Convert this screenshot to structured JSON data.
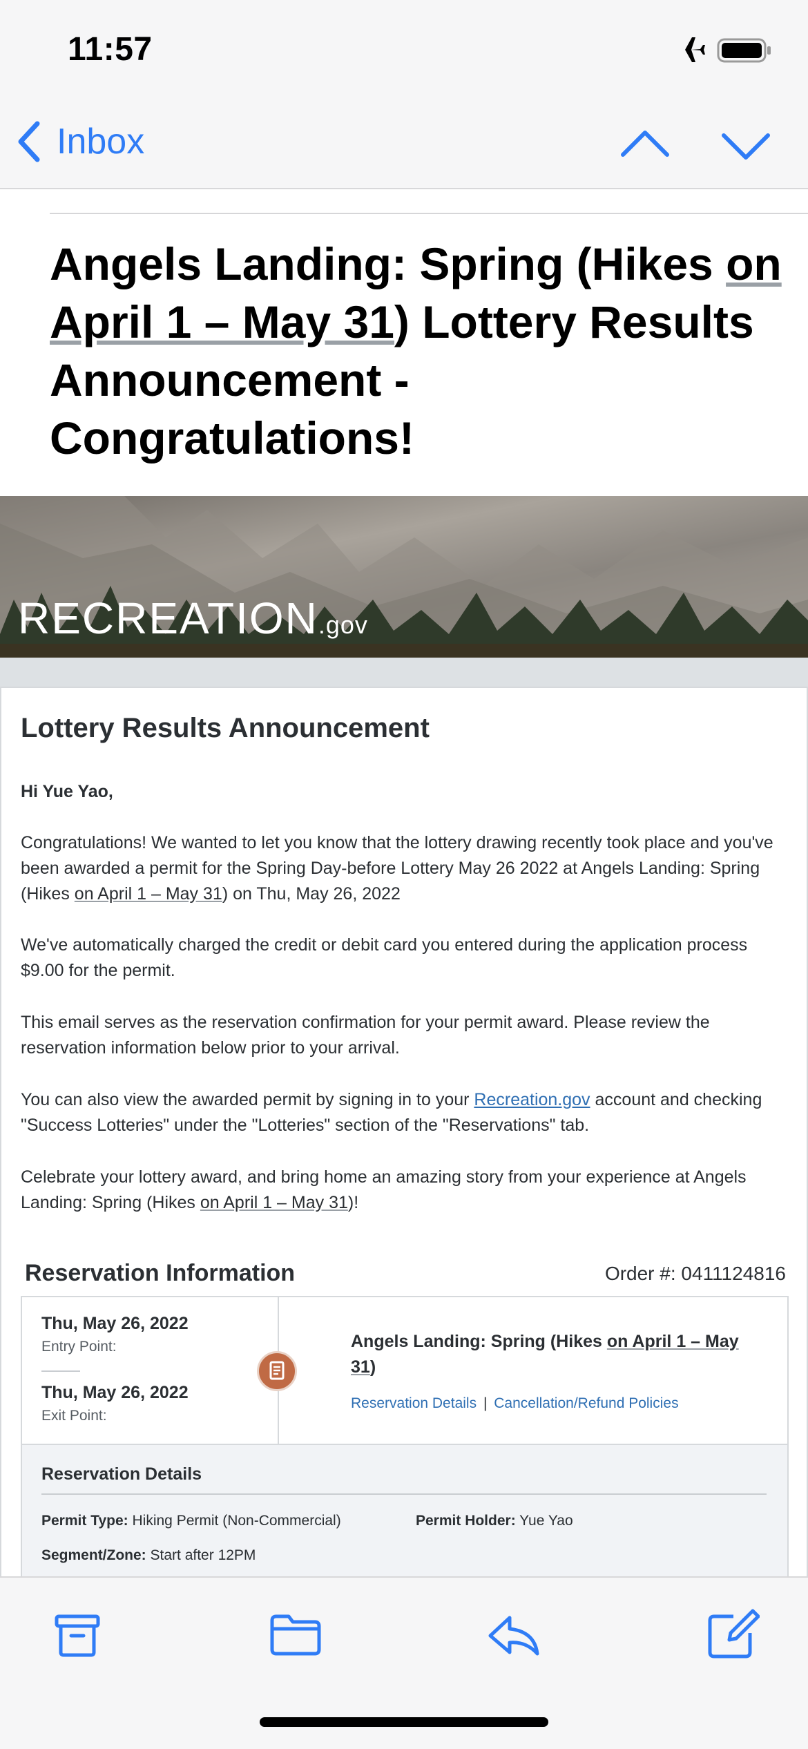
{
  "status": {
    "time": "11:57"
  },
  "nav": {
    "back_label": "Inbox"
  },
  "email": {
    "subject": {
      "part1": "Angels Landing: Spring (Hikes ",
      "underlined": "on April 1 – May 31",
      "part2": ") Lottery Results Announcement - Congratulations!"
    },
    "banner": {
      "logo_main": "RECREATION",
      "logo_suffix": ".gov"
    },
    "card": {
      "title": "Lottery Results Announcement",
      "greeting": "Hi Yue Yao,",
      "p1_a": "Congratulations! We wanted to let you know that the lottery drawing recently took place and you've been awarded a permit for the Spring Day-before Lottery May 26 2022 at Angels Landing: Spring (Hikes ",
      "p1_ul": "on April 1 – May 31",
      "p1_b": ") on Thu, May 26, 2022",
      "p2": "We've automatically charged the credit or debit card you entered during the application process $9.00 for the permit.",
      "p3": "This email serves as the reservation confirmation for your permit award. Please review the reservation information below prior to your arrival.",
      "p4_a": "You can also view the awarded permit by signing in to your ",
      "p4_link": "Recreation.gov",
      "p4_b": " account and checking \"Success Lotteries\" under the \"Lotteries\" section of the \"Reservations\" tab.",
      "p5_a": "Celebrate your lottery award, and bring home an amazing story from your experience at Angels Landing: Spring (Hikes ",
      "p5_ul": "on April 1 – May 31",
      "p5_b": ")!"
    },
    "reservation": {
      "heading": "Reservation Information",
      "order": "Order #: 0411124816",
      "entry_date": "Thu, May 26, 2022",
      "entry_label": "Entry Point:",
      "exit_date": "Thu, May 26, 2022",
      "exit_label": "Exit Point:",
      "title_a": "Angels Landing: Spring (Hikes ",
      "title_ul": "on April 1 – May 31",
      "title_b": ")",
      "link_details": "Reservation Details",
      "link_sep": "|",
      "link_policies": "Cancellation/Refund Policies",
      "details_title": "Reservation Details",
      "permit_type_label": "Permit Type:",
      "permit_type_value": "Hiking Permit (Non-Commercial)",
      "permit_holder_label": "Permit Holder:",
      "permit_holder_value": "Yue Yao",
      "segment_label": "Segment/Zone:",
      "segment_value": "Start after 12PM"
    }
  },
  "toolbar": {
    "icons": [
      "archive-icon",
      "folder-icon",
      "reply-icon",
      "compose-icon"
    ]
  },
  "colors": {
    "accent": "#2f7cf6",
    "link": "#2f6fb3",
    "badge": "#c06a44"
  }
}
